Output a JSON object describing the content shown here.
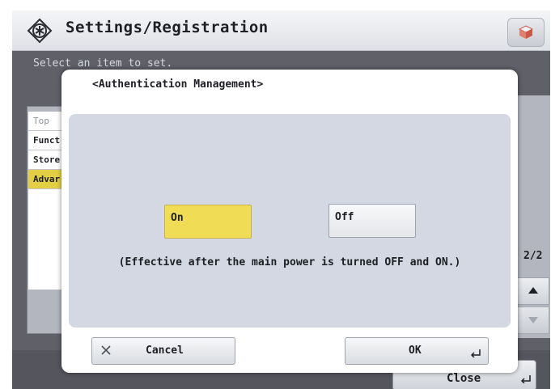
{
  "header": {
    "title": "Settings/Registration",
    "icon": "settings-star-icon",
    "corner_button_icon": "cube-icon"
  },
  "subtitle": "Select an item to set.",
  "background_list": {
    "items": [
      {
        "label": "Top"
      },
      {
        "label": "Funct"
      },
      {
        "label": "Store"
      },
      {
        "label": "Advar",
        "highlighted": true
      }
    ]
  },
  "pager": {
    "indicator": "2/2",
    "up_icon": "arrow-up-icon",
    "down_icon": "arrow-down-icon"
  },
  "footer": {
    "close_label": "Close"
  },
  "dialog": {
    "title": "<Authentication Management>",
    "options": [
      {
        "label": "On",
        "selected": true
      },
      {
        "label": "Off",
        "selected": false
      }
    ],
    "note": "(Effective after the main power is turned OFF and ON.)",
    "cancel_label": "Cancel",
    "ok_label": "OK"
  },
  "colors": {
    "selected_option": "#f1dc55",
    "panel": "#d3d8e2",
    "screen_bg": "#5f6068"
  }
}
